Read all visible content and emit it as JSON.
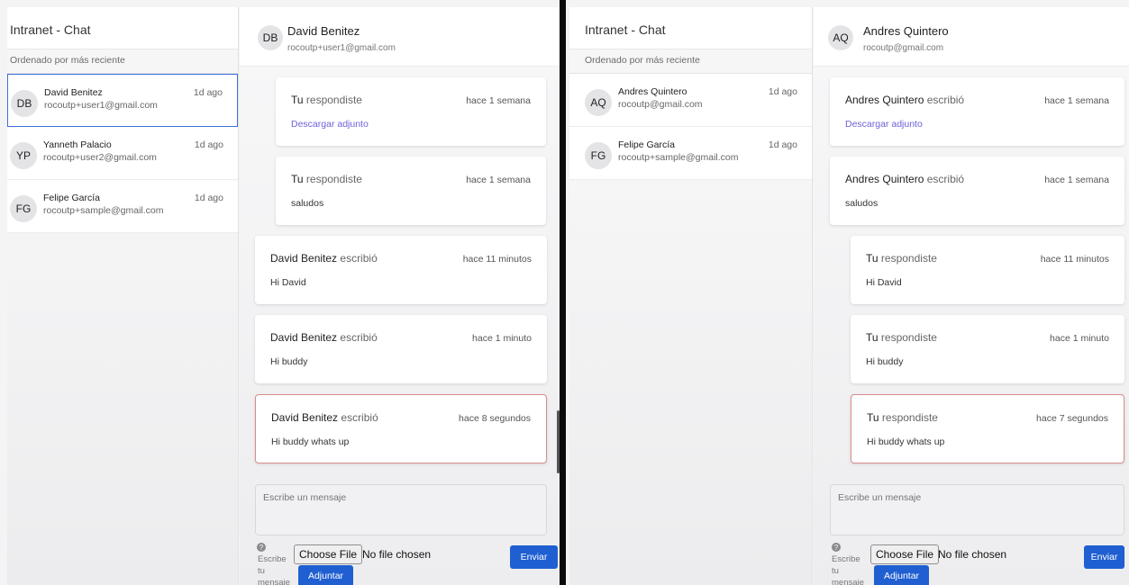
{
  "left_window": {
    "sidebar": {
      "title": "Intranet - Chat",
      "sort_label": "Ordenado por más reciente",
      "contacts": [
        {
          "initials": "DB",
          "name": "David Benitez",
          "email": "rocoutp+user1@gmail.com",
          "time": "1d ago"
        },
        {
          "initials": "YP",
          "name": "Yanneth Palacio",
          "email": "rocoutp+user2@gmail.com",
          "time": "1d ago"
        },
        {
          "initials": "FG",
          "name": "Felipe García",
          "email": "rocoutp+sample@gmail.com",
          "time": "1d ago"
        }
      ]
    },
    "chat": {
      "initials": "DB",
      "name": "David Benitez",
      "email": "rocoutp+user1@gmail.com",
      "messages": [
        {
          "author": "Tu",
          "verb": "respondiste",
          "time": "hace 1 semana",
          "link": "Descargar adjunto"
        },
        {
          "author": "Tu",
          "verb": "respondiste",
          "time": "hace 1 semana",
          "text": "saludos"
        },
        {
          "author": "David Benitez",
          "verb": "escribió",
          "time": "hace 11 minutos",
          "text": "Hi David"
        },
        {
          "author": "David Benitez",
          "verb": "escribió",
          "time": "hace 1 minuto",
          "text": "Hi buddy"
        },
        {
          "author": "David Benitez",
          "verb": "escribió",
          "time": "hace 8 segundos",
          "text": "Hi buddy whats up"
        }
      ],
      "composer_placeholder": "Escribe un mensaje",
      "help_text": "Escribe tu mensaje",
      "choose_file_label": "Choose File",
      "file_status": "No file chosen",
      "attach_label": "Adjuntar",
      "send_label": "Enviar"
    }
  },
  "right_window": {
    "sidebar": {
      "title": "Intranet - Chat",
      "sort_label": "Ordenado por más reciente",
      "contacts": [
        {
          "initials": "AQ",
          "name": "Andres Quintero",
          "email": "rocoutp@gmail.com",
          "time": "1d ago"
        },
        {
          "initials": "FG",
          "name": "Felipe García",
          "email": "rocoutp+sample@gmail.com",
          "time": "1d ago"
        }
      ]
    },
    "chat": {
      "initials": "AQ",
      "name": "Andres Quintero",
      "email": "rocoutp@gmail.com",
      "messages": [
        {
          "author": "Andres Quintero",
          "verb": "escribió",
          "time": "hace 1 semana",
          "link": "Descargar adjunto"
        },
        {
          "author": "Andres Quintero",
          "verb": "escribió",
          "time": "hace 1 semana",
          "text": "saludos"
        },
        {
          "author": "Tu",
          "verb": "respondiste",
          "time": "hace 11 minutos",
          "text": "Hi David"
        },
        {
          "author": "Tu",
          "verb": "respondiste",
          "time": "hace 1 minuto",
          "text": "Hi buddy"
        },
        {
          "author": "Tu",
          "verb": "respondiste",
          "time": "hace 7 segundos",
          "text": "Hi buddy whats up"
        }
      ],
      "composer_placeholder": "Escribe un mensaje",
      "help_text": "Escribe tu mensaje",
      "choose_file_label": "Choose File",
      "file_status": "No file chosen",
      "attach_label": "Adjuntar",
      "send_label": "Enviar"
    }
  },
  "colors": {
    "accent": "#1f5fd1",
    "active_border": "#3b6fd8",
    "new_message_border": "#d98d8d",
    "link": "#6a63d8"
  }
}
